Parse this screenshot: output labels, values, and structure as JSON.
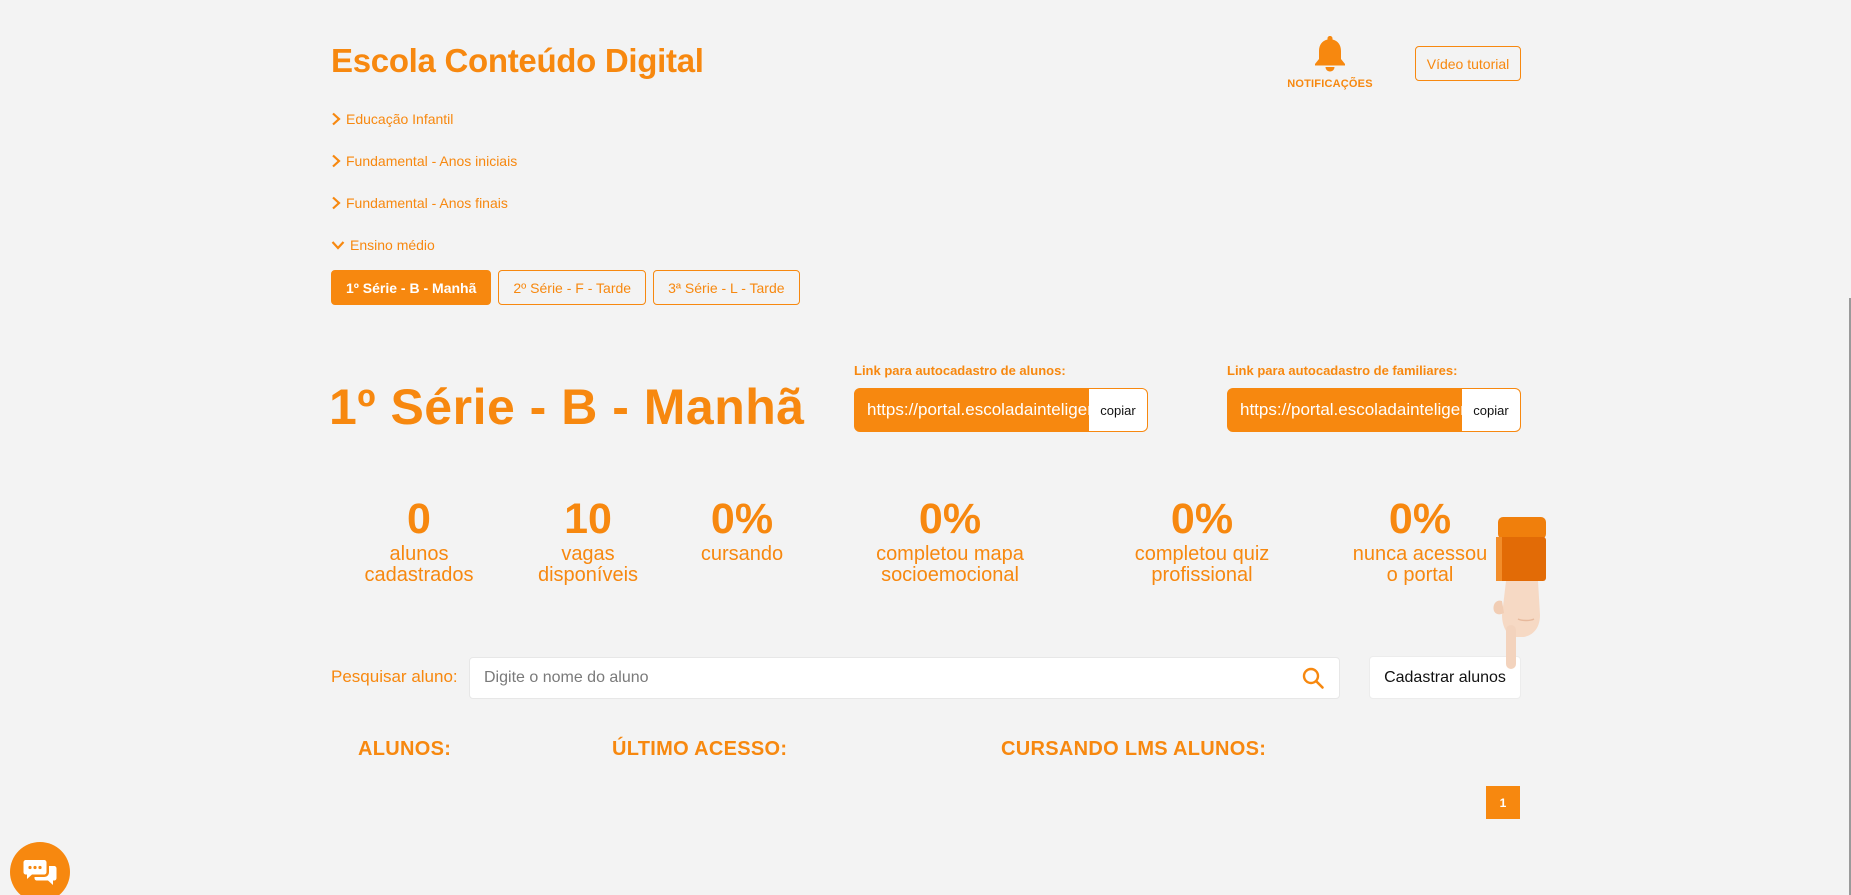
{
  "header": {
    "title": "Escola Conteúdo Digital",
    "notifications_label": "NOTIFICAÇÕES",
    "video_tutorial_label": "Vídeo tutorial"
  },
  "levels": [
    {
      "label": "Educação Infantil",
      "expanded": false
    },
    {
      "label": "Fundamental - Anos iniciais",
      "expanded": false
    },
    {
      "label": "Fundamental - Anos finais",
      "expanded": false
    },
    {
      "label": "Ensino médio",
      "expanded": true
    }
  ],
  "class_tabs": [
    {
      "label": "1º Série - B - Manhã",
      "active": true
    },
    {
      "label": "2º Série - F - Tarde",
      "active": false
    },
    {
      "label": "3ª Série - L - Tarde",
      "active": false
    }
  ],
  "selected_class": {
    "title": "1º Série - B - Manhã"
  },
  "links": {
    "students": {
      "label": "Link para autocadastro de alunos:",
      "url": "https://portal.escoladainteligencia",
      "copy_label": "copiar"
    },
    "families": {
      "label": "Link para autocadastro de familiares:",
      "url": "https://portal.escoladainteligencia",
      "copy_label": "copiar"
    }
  },
  "stats": [
    {
      "value": "0",
      "label_line1": "alunos",
      "label_line2": "cadastrados"
    },
    {
      "value": "10",
      "label_line1": "vagas",
      "label_line2": "disponíveis"
    },
    {
      "value": "0%",
      "label_line1": "cursando",
      "label_line2": ""
    },
    {
      "value": "0%",
      "label_line1": "completou mapa",
      "label_line2": "socioemocional"
    },
    {
      "value": "0%",
      "label_line1": "completou quiz",
      "label_line2": "profissional"
    },
    {
      "value": "0%",
      "label_line1": "nunca acessou",
      "label_line2": "o portal"
    }
  ],
  "search": {
    "label": "Pesquisar aluno:",
    "placeholder": "Digite o nome do aluno",
    "value": ""
  },
  "register_button_label": "Cadastrar alunos",
  "table": {
    "columns": [
      "ALUNOS:",
      "ÚLTIMO ACESSO:",
      "CURSANDO LMS ALUNOS:"
    ]
  },
  "pagination": {
    "current_page": "1"
  },
  "colors": {
    "accent": "#f7880f",
    "background": "#f3f3f3"
  },
  "icons": {
    "notifications": "bell-icon",
    "search": "search-icon",
    "chat": "chat-icon",
    "expand": "chevron-right-icon",
    "collapse": "chevron-down-icon",
    "pointer": "pointing-hand-icon"
  }
}
